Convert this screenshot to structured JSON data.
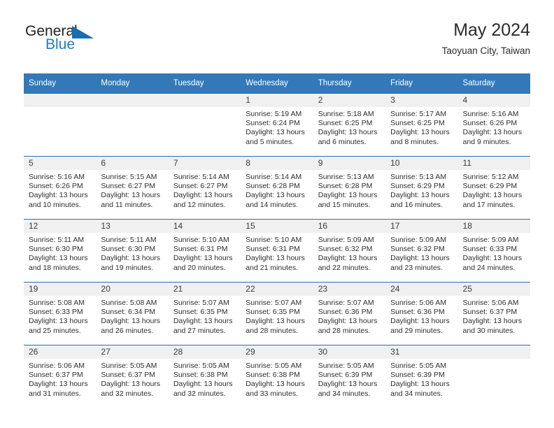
{
  "brand": {
    "word_one": "General",
    "word_two": "Blue",
    "triangle_icon": "triangle-icon",
    "colors": {
      "general": "#222222",
      "blue": "#1f7dc4",
      "triangle": "#1b6cb0"
    }
  },
  "header": {
    "title": "May 2024",
    "subtitle": "Taoyuan City, Taiwan"
  },
  "theme": {
    "header_row_bg": "#3379b8",
    "header_row_text": "#ffffff",
    "daynum_band_bg": "#f0f0f0",
    "row_divider": "#2f6da8"
  },
  "calendar": {
    "weekday_headers": [
      "Sunday",
      "Monday",
      "Tuesday",
      "Wednesday",
      "Thursday",
      "Friday",
      "Saturday"
    ],
    "labels": {
      "sunrise": "Sunrise:",
      "sunset": "Sunset:",
      "daylight": "Daylight:"
    },
    "weeks": [
      [
        {
          "day": "",
          "sunrise": "",
          "sunset": "",
          "daylight_1": "",
          "daylight_2": ""
        },
        {
          "day": "",
          "sunrise": "",
          "sunset": "",
          "daylight_1": "",
          "daylight_2": ""
        },
        {
          "day": "",
          "sunrise": "",
          "sunset": "",
          "daylight_1": "",
          "daylight_2": ""
        },
        {
          "day": "1",
          "sunrise": "Sunrise: 5:19 AM",
          "sunset": "Sunset: 6:24 PM",
          "daylight_1": "Daylight: 13 hours",
          "daylight_2": "and 5 minutes."
        },
        {
          "day": "2",
          "sunrise": "Sunrise: 5:18 AM",
          "sunset": "Sunset: 6:25 PM",
          "daylight_1": "Daylight: 13 hours",
          "daylight_2": "and 6 minutes."
        },
        {
          "day": "3",
          "sunrise": "Sunrise: 5:17 AM",
          "sunset": "Sunset: 6:25 PM",
          "daylight_1": "Daylight: 13 hours",
          "daylight_2": "and 8 minutes."
        },
        {
          "day": "4",
          "sunrise": "Sunrise: 5:16 AM",
          "sunset": "Sunset: 6:26 PM",
          "daylight_1": "Daylight: 13 hours",
          "daylight_2": "and 9 minutes."
        }
      ],
      [
        {
          "day": "5",
          "sunrise": "Sunrise: 5:16 AM",
          "sunset": "Sunset: 6:26 PM",
          "daylight_1": "Daylight: 13 hours",
          "daylight_2": "and 10 minutes."
        },
        {
          "day": "6",
          "sunrise": "Sunrise: 5:15 AM",
          "sunset": "Sunset: 6:27 PM",
          "daylight_1": "Daylight: 13 hours",
          "daylight_2": "and 11 minutes."
        },
        {
          "day": "7",
          "sunrise": "Sunrise: 5:14 AM",
          "sunset": "Sunset: 6:27 PM",
          "daylight_1": "Daylight: 13 hours",
          "daylight_2": "and 12 minutes."
        },
        {
          "day": "8",
          "sunrise": "Sunrise: 5:14 AM",
          "sunset": "Sunset: 6:28 PM",
          "daylight_1": "Daylight: 13 hours",
          "daylight_2": "and 14 minutes."
        },
        {
          "day": "9",
          "sunrise": "Sunrise: 5:13 AM",
          "sunset": "Sunset: 6:28 PM",
          "daylight_1": "Daylight: 13 hours",
          "daylight_2": "and 15 minutes."
        },
        {
          "day": "10",
          "sunrise": "Sunrise: 5:13 AM",
          "sunset": "Sunset: 6:29 PM",
          "daylight_1": "Daylight: 13 hours",
          "daylight_2": "and 16 minutes."
        },
        {
          "day": "11",
          "sunrise": "Sunrise: 5:12 AM",
          "sunset": "Sunset: 6:29 PM",
          "daylight_1": "Daylight: 13 hours",
          "daylight_2": "and 17 minutes."
        }
      ],
      [
        {
          "day": "12",
          "sunrise": "Sunrise: 5:11 AM",
          "sunset": "Sunset: 6:30 PM",
          "daylight_1": "Daylight: 13 hours",
          "daylight_2": "and 18 minutes."
        },
        {
          "day": "13",
          "sunrise": "Sunrise: 5:11 AM",
          "sunset": "Sunset: 6:30 PM",
          "daylight_1": "Daylight: 13 hours",
          "daylight_2": "and 19 minutes."
        },
        {
          "day": "14",
          "sunrise": "Sunrise: 5:10 AM",
          "sunset": "Sunset: 6:31 PM",
          "daylight_1": "Daylight: 13 hours",
          "daylight_2": "and 20 minutes."
        },
        {
          "day": "15",
          "sunrise": "Sunrise: 5:10 AM",
          "sunset": "Sunset: 6:31 PM",
          "daylight_1": "Daylight: 13 hours",
          "daylight_2": "and 21 minutes."
        },
        {
          "day": "16",
          "sunrise": "Sunrise: 5:09 AM",
          "sunset": "Sunset: 6:32 PM",
          "daylight_1": "Daylight: 13 hours",
          "daylight_2": "and 22 minutes."
        },
        {
          "day": "17",
          "sunrise": "Sunrise: 5:09 AM",
          "sunset": "Sunset: 6:32 PM",
          "daylight_1": "Daylight: 13 hours",
          "daylight_2": "and 23 minutes."
        },
        {
          "day": "18",
          "sunrise": "Sunrise: 5:09 AM",
          "sunset": "Sunset: 6:33 PM",
          "daylight_1": "Daylight: 13 hours",
          "daylight_2": "and 24 minutes."
        }
      ],
      [
        {
          "day": "19",
          "sunrise": "Sunrise: 5:08 AM",
          "sunset": "Sunset: 6:33 PM",
          "daylight_1": "Daylight: 13 hours",
          "daylight_2": "and 25 minutes."
        },
        {
          "day": "20",
          "sunrise": "Sunrise: 5:08 AM",
          "sunset": "Sunset: 6:34 PM",
          "daylight_1": "Daylight: 13 hours",
          "daylight_2": "and 26 minutes."
        },
        {
          "day": "21",
          "sunrise": "Sunrise: 5:07 AM",
          "sunset": "Sunset: 6:35 PM",
          "daylight_1": "Daylight: 13 hours",
          "daylight_2": "and 27 minutes."
        },
        {
          "day": "22",
          "sunrise": "Sunrise: 5:07 AM",
          "sunset": "Sunset: 6:35 PM",
          "daylight_1": "Daylight: 13 hours",
          "daylight_2": "and 28 minutes."
        },
        {
          "day": "23",
          "sunrise": "Sunrise: 5:07 AM",
          "sunset": "Sunset: 6:36 PM",
          "daylight_1": "Daylight: 13 hours",
          "daylight_2": "and 28 minutes."
        },
        {
          "day": "24",
          "sunrise": "Sunrise: 5:06 AM",
          "sunset": "Sunset: 6:36 PM",
          "daylight_1": "Daylight: 13 hours",
          "daylight_2": "and 29 minutes."
        },
        {
          "day": "25",
          "sunrise": "Sunrise: 5:06 AM",
          "sunset": "Sunset: 6:37 PM",
          "daylight_1": "Daylight: 13 hours",
          "daylight_2": "and 30 minutes."
        }
      ],
      [
        {
          "day": "26",
          "sunrise": "Sunrise: 5:06 AM",
          "sunset": "Sunset: 6:37 PM",
          "daylight_1": "Daylight: 13 hours",
          "daylight_2": "and 31 minutes."
        },
        {
          "day": "27",
          "sunrise": "Sunrise: 5:05 AM",
          "sunset": "Sunset: 6:37 PM",
          "daylight_1": "Daylight: 13 hours",
          "daylight_2": "and 32 minutes."
        },
        {
          "day": "28",
          "sunrise": "Sunrise: 5:05 AM",
          "sunset": "Sunset: 6:38 PM",
          "daylight_1": "Daylight: 13 hours",
          "daylight_2": "and 32 minutes."
        },
        {
          "day": "29",
          "sunrise": "Sunrise: 5:05 AM",
          "sunset": "Sunset: 6:38 PM",
          "daylight_1": "Daylight: 13 hours",
          "daylight_2": "and 33 minutes."
        },
        {
          "day": "30",
          "sunrise": "Sunrise: 5:05 AM",
          "sunset": "Sunset: 6:39 PM",
          "daylight_1": "Daylight: 13 hours",
          "daylight_2": "and 34 minutes."
        },
        {
          "day": "31",
          "sunrise": "Sunrise: 5:05 AM",
          "sunset": "Sunset: 6:39 PM",
          "daylight_1": "Daylight: 13 hours",
          "daylight_2": "and 34 minutes."
        },
        {
          "day": "",
          "sunrise": "",
          "sunset": "",
          "daylight_1": "",
          "daylight_2": ""
        }
      ]
    ]
  }
}
